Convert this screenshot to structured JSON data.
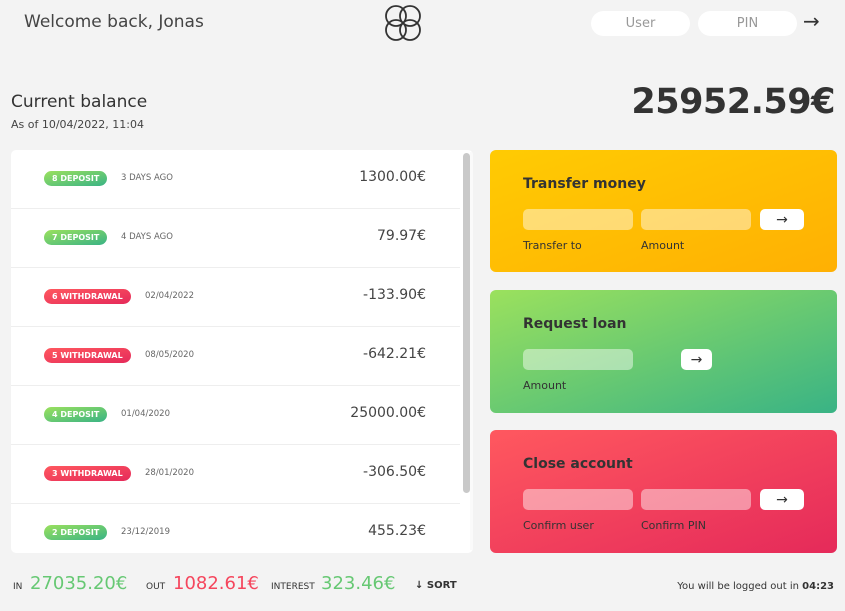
{
  "nav": {
    "welcome": "Welcome back, Jonas",
    "user_placeholder": "User",
    "pin_placeholder": "PIN",
    "login_arrow": "→"
  },
  "balance": {
    "label": "Current balance",
    "date": "As of 10/04/2022, 11:04",
    "value": "25952.59€"
  },
  "movements": [
    {
      "badge": "8 deposit",
      "type": "deposit",
      "date": "3 days ago",
      "value": "1300.00€"
    },
    {
      "badge": "7 deposit",
      "type": "deposit",
      "date": "4 days ago",
      "value": "79.97€"
    },
    {
      "badge": "6 withdrawal",
      "type": "withdrawal",
      "date": "02/04/2022",
      "value": "-133.90€"
    },
    {
      "badge": "5 withdrawal",
      "type": "withdrawal",
      "date": "08/05/2020",
      "value": "-642.21€"
    },
    {
      "badge": "4 deposit",
      "type": "deposit",
      "date": "01/04/2020",
      "value": "25000.00€"
    },
    {
      "badge": "3 withdrawal",
      "type": "withdrawal",
      "date": "28/01/2020",
      "value": "-306.50€"
    },
    {
      "badge": "2 deposit",
      "type": "deposit",
      "date": "23/12/2019",
      "value": "455.23€"
    }
  ],
  "transfer": {
    "title": "Transfer money",
    "to_label": "Transfer to",
    "amount_label": "Amount",
    "button": "→"
  },
  "loan": {
    "title": "Request loan",
    "amount_label": "Amount",
    "button": "→"
  },
  "close": {
    "title": "Close account",
    "user_label": "Confirm user",
    "pin_label": "Confirm PIN",
    "button": "→"
  },
  "summary": {
    "in_label": "In",
    "in_value": "27035.20€",
    "out_label": "Out",
    "out_value": "1082.61€",
    "interest_label": "Interest",
    "interest_value": "323.46€",
    "sort_label": "↓ SORT"
  },
  "timer": {
    "text": "You will be logged out in",
    "time": "04:23"
  },
  "colors": {
    "deposit": "#66c873",
    "withdrawal": "#f5465d",
    "transfer": "#ffb003",
    "loan": "#39b385",
    "close": "#e52a5a"
  }
}
